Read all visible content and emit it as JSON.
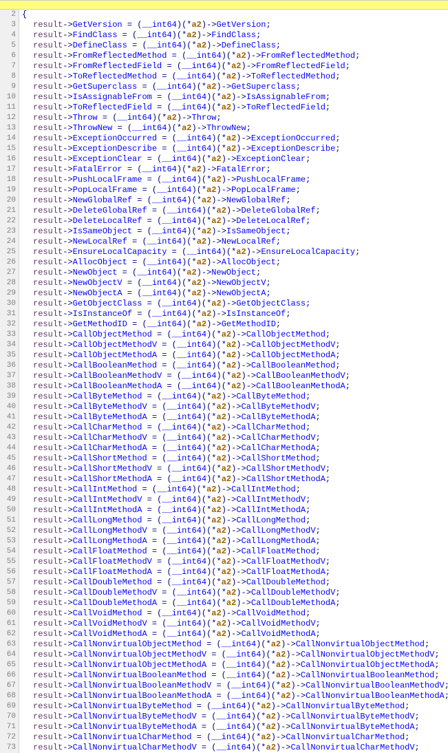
{
  "startLine": 2,
  "resultVar": "result",
  "castType": "__int64",
  "argName": "a2",
  "members": [
    "GetVersion",
    "FindClass",
    "DefineClass",
    "FromReflectedMethod",
    "FromReflectedField",
    "ToReflectedMethod",
    "GetSuperclass",
    "IsAssignableFrom",
    "ToReflectedField",
    "Throw",
    "ThrowNew",
    "ExceptionOccurred",
    "ExceptionDescribe",
    "ExceptionClear",
    "FatalError",
    "PushLocalFrame",
    "PopLocalFrame",
    "NewGlobalRef",
    "DeleteGlobalRef",
    "DeleteLocalRef",
    "IsSameObject",
    "NewLocalRef",
    "EnsureLocalCapacity",
    "AllocObject",
    "NewObject",
    "NewObjectV",
    "NewObjectA",
    "GetObjectClass",
    "IsInstanceOf",
    "GetMethodID",
    "CallObjectMethod",
    "CallObjectMethodV",
    "CallObjectMethodA",
    "CallBooleanMethod",
    "CallBooleanMethodV",
    "CallBooleanMethodA",
    "CallByteMethod",
    "CallByteMethodV",
    "CallByteMethodA",
    "CallCharMethod",
    "CallCharMethodV",
    "CallCharMethodA",
    "CallShortMethod",
    "CallShortMethodV",
    "CallShortMethodA",
    "CallIntMethod",
    "CallIntMethodV",
    "CallIntMethodA",
    "CallLongMethod",
    "CallLongMethodV",
    "CallLongMethodA",
    "CallFloatMethod",
    "CallFloatMethodV",
    "CallFloatMethodA",
    "CallDoubleMethod",
    "CallDoubleMethodV",
    "CallDoubleMethodA",
    "CallVoidMethod",
    "CallVoidMethodV",
    "CallVoidMethodA",
    "CallNonvirtualObjectMethod",
    "CallNonvirtualObjectMethodV",
    "CallNonvirtualObjectMethodA",
    "CallNonvirtualBooleanMethod",
    "CallNonvirtualBooleanMethodV",
    "CallNonvirtualBooleanMethodA",
    "CallNonvirtualByteMethod",
    "CallNonvirtualByteMethodV",
    "CallNonvirtualByteMethodA",
    "CallNonvirtualCharMethod",
    "CallNonvirtualCharMethodV"
  ]
}
